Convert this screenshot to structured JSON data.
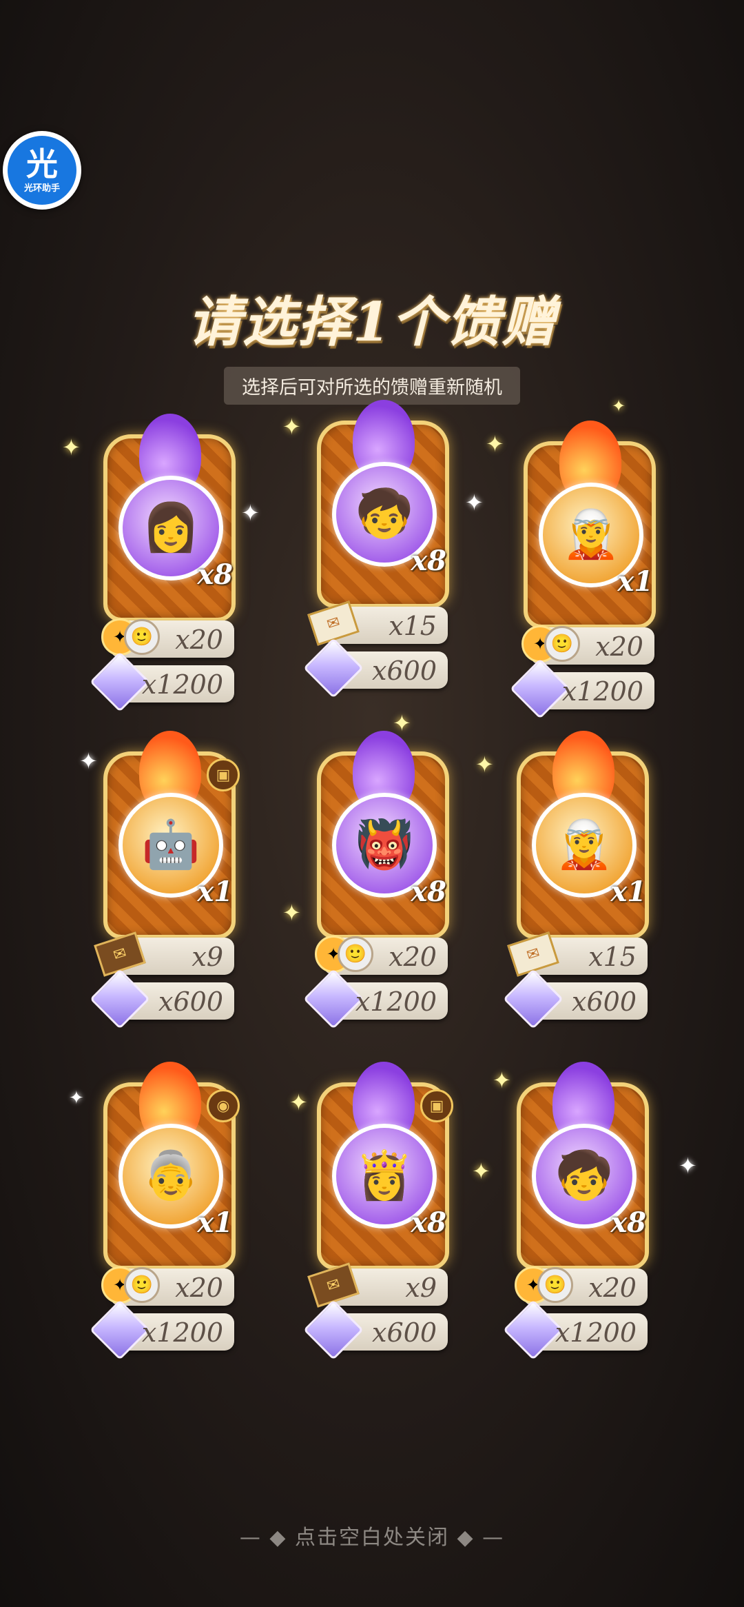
{
  "overlay": {
    "app_badge": {
      "glyph": "光",
      "name": "光环助手"
    },
    "title": "请选择1个馈赠",
    "subtitle": "选择后可对所选的馈赠重新随机",
    "close_hint": "— ◆ 点击空白处关闭 ◆ —"
  },
  "gifts": [
    {
      "element": "purple",
      "face": "👩",
      "multiplier": "x8",
      "badge": "",
      "reward1": {
        "icon": "token-with-avatar",
        "value": "x20"
      },
      "reward2": {
        "icon": "diamond",
        "value": "x1200"
      }
    },
    {
      "element": "purple",
      "face": "🧒",
      "multiplier": "x8",
      "badge": "",
      "reward1": {
        "icon": "letter",
        "value": "x15"
      },
      "reward2": {
        "icon": "diamond",
        "value": "x600"
      }
    },
    {
      "element": "fire",
      "face": "🧝",
      "multiplier": "x1",
      "badge": "",
      "reward1": {
        "icon": "token-with-avatar",
        "value": "x20"
      },
      "reward2": {
        "icon": "diamond",
        "value": "x1200"
      }
    },
    {
      "element": "fire",
      "face": "🤖",
      "multiplier": "x1",
      "badge": "▣",
      "reward1": {
        "icon": "letter-dark",
        "value": "x9"
      },
      "reward2": {
        "icon": "diamond",
        "value": "x600"
      }
    },
    {
      "element": "purple",
      "face": "👹",
      "multiplier": "x8",
      "badge": "",
      "reward1": {
        "icon": "token-with-avatar",
        "value": "x20"
      },
      "reward2": {
        "icon": "diamond",
        "value": "x1200"
      }
    },
    {
      "element": "fire",
      "face": "🧝",
      "multiplier": "x1",
      "badge": "",
      "reward1": {
        "icon": "letter",
        "value": "x15"
      },
      "reward2": {
        "icon": "diamond",
        "value": "x600"
      }
    },
    {
      "element": "fire",
      "face": "👵",
      "multiplier": "x1",
      "badge": "◉",
      "reward1": {
        "icon": "token-with-avatar",
        "value": "x20"
      },
      "reward2": {
        "icon": "diamond",
        "value": "x1200"
      }
    },
    {
      "element": "purple",
      "face": "👸",
      "multiplier": "x8",
      "badge": "▣",
      "reward1": {
        "icon": "letter-dark",
        "value": "x9"
      },
      "reward2": {
        "icon": "diamond",
        "value": "x600"
      }
    },
    {
      "element": "purple",
      "face": "🧒",
      "multiplier": "x8",
      "badge": "",
      "reward1": {
        "icon": "token-with-avatar",
        "value": "x20"
      },
      "reward2": {
        "icon": "diamond",
        "value": "x1200"
      }
    }
  ]
}
